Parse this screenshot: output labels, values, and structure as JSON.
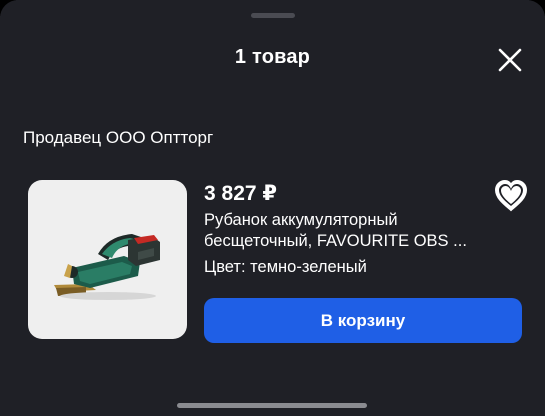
{
  "sheet": {
    "title": "1 товар",
    "seller": "Продавец ООО Оптторг"
  },
  "product": {
    "price": "3 827 ₽",
    "name_line1": "Рубанок аккумуляторный",
    "name_line2": "бесщеточный, FAVOURITE OBS ...",
    "color": "Цвет: темно-зеленый",
    "image_icon": "cordless-planer-image",
    "favorite_icon": "heart-icon"
  },
  "actions": {
    "add_to_cart": "В корзину",
    "close_icon": "close-icon"
  },
  "colors": {
    "background": "#1f2026",
    "accent": "#1f5fe6",
    "text": "#ffffff"
  }
}
